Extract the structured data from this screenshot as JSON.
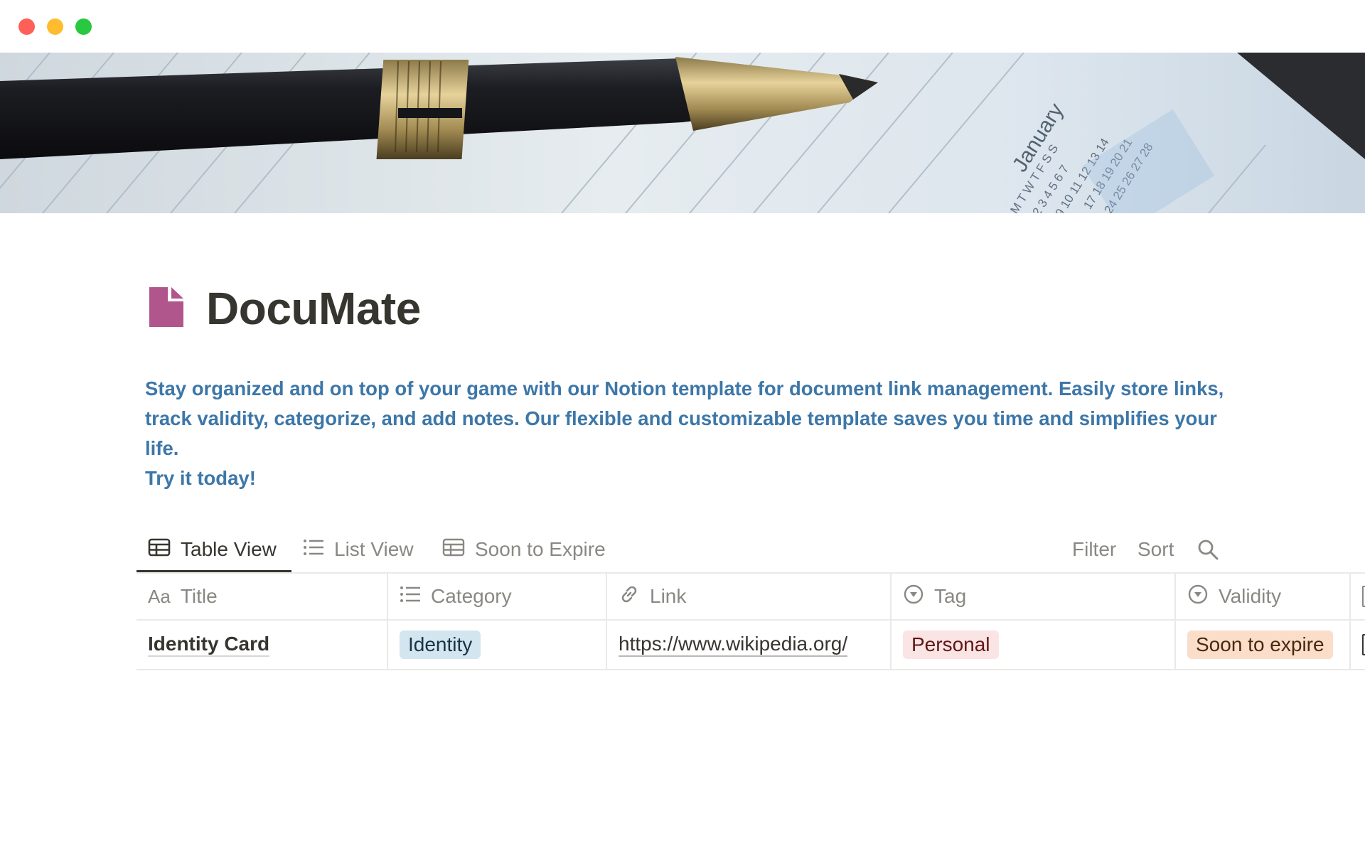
{
  "window": {
    "controls": [
      "close",
      "minimize",
      "maximize"
    ],
    "colors": {
      "close": "#fe5f57",
      "minimize": "#febc2e",
      "maximize": "#28c840"
    }
  },
  "cover": {
    "icon": "cover-photo",
    "calendar": {
      "month": "January",
      "weekdays": [
        "M",
        "T",
        "W",
        "T",
        "F",
        "S",
        "S"
      ],
      "row1": [
        "1",
        "2",
        "3",
        "4",
        "5",
        "6",
        "7"
      ],
      "row2": [
        "9",
        "10",
        "11",
        "12",
        "13",
        "14"
      ],
      "row3": [
        "17",
        "18",
        "19",
        "20",
        "21"
      ],
      "row4": [
        "24",
        "25",
        "26",
        "27",
        "28"
      ]
    }
  },
  "page": {
    "icon": "document-icon",
    "icon_color": "#b1568c",
    "title": "DocuMate",
    "description_lines": [
      "Stay organized and on top of your game with our Notion template for document link management. Easily store links, track validity, categorize, and add notes. Our flexible and customizable template saves you time and simplifies your life.",
      "Try it today!"
    ],
    "description_color": "#3d77a8"
  },
  "views": {
    "tabs": [
      {
        "label": "Table View",
        "icon": "table-icon",
        "active": true
      },
      {
        "label": "List View",
        "icon": "list-icon",
        "active": false
      },
      {
        "label": "Soon to Expire",
        "icon": "table-icon",
        "active": false
      }
    ],
    "tools": {
      "filter": "Filter",
      "sort": "Sort",
      "search_icon": "search-icon"
    }
  },
  "table": {
    "columns": [
      {
        "label": "Title",
        "icon": "text-icon",
        "icon_text": "Aa"
      },
      {
        "label": "Category",
        "icon": "list-icon"
      },
      {
        "label": "Link",
        "icon": "link-icon"
      },
      {
        "label": "Tag",
        "icon": "select-icon"
      },
      {
        "label": "Validity",
        "icon": "select-icon"
      }
    ],
    "rows": [
      {
        "title": "Identity Card",
        "category": "Identity",
        "link": "https://www.wikipedia.org/",
        "tag": "Personal",
        "validity": "Soon to expire"
      }
    ],
    "pill_colors": {
      "Identity": "#d3e5ef",
      "Personal": "#fbe4e4",
      "Soon to expire": "#fadec9"
    }
  }
}
